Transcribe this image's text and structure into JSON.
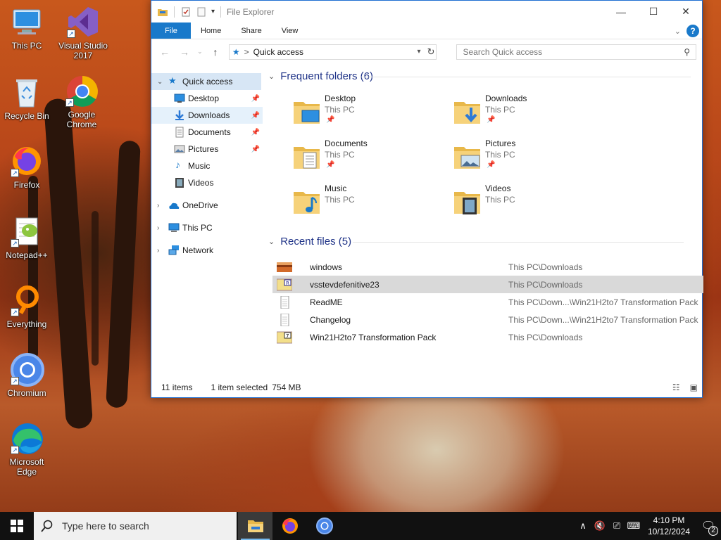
{
  "desktop": {
    "icons": [
      {
        "label": "This PC",
        "icon": "this-pc-icon"
      },
      {
        "label": "Visual Studio 2017",
        "icon": "visual-studio-icon"
      },
      {
        "label": "Recycle Bin",
        "icon": "recycle-bin-icon"
      },
      {
        "label": "Google Chrome",
        "icon": "chrome-icon"
      },
      {
        "label": "Firefox",
        "icon": "firefox-icon"
      },
      {
        "label": "Notepad++",
        "icon": "notepadpp-icon"
      },
      {
        "label": "Everything",
        "icon": "everything-icon"
      },
      {
        "label": "Chromium",
        "icon": "chromium-icon"
      },
      {
        "label": "Microsoft Edge",
        "icon": "edge-icon"
      }
    ]
  },
  "window": {
    "title": "File Explorer",
    "ribbon_tabs": [
      "File",
      "Home",
      "Share",
      "View"
    ],
    "address": {
      "location": "Quick access",
      "separator": ">"
    },
    "search_placeholder": "Search Quick access",
    "nav": {
      "quick_access": "Quick access",
      "pinned": [
        "Desktop",
        "Downloads",
        "Documents",
        "Pictures"
      ],
      "unpinned": [
        "Music",
        "Videos"
      ],
      "onedrive": "OneDrive",
      "this_pc": "This PC",
      "network": "Network"
    },
    "frequent": {
      "header": "Frequent folders (6)",
      "folders": [
        {
          "name": "Desktop",
          "location": "This PC",
          "pinned": true
        },
        {
          "name": "Downloads",
          "location": "This PC",
          "pinned": true
        },
        {
          "name": "Documents",
          "location": "This PC",
          "pinned": true
        },
        {
          "name": "Pictures",
          "location": "This PC",
          "pinned": true
        },
        {
          "name": "Music",
          "location": "This PC",
          "pinned": false
        },
        {
          "name": "Videos",
          "location": "This PC",
          "pinned": false
        }
      ]
    },
    "recent": {
      "header": "Recent files (5)",
      "files": [
        {
          "name": "windows",
          "path": "This PC\\Downloads"
        },
        {
          "name": "vsstevdefenitive23",
          "path": "This PC\\Downloads"
        },
        {
          "name": "ReadME",
          "path": "This PC\\Down...\\Win21H2to7 Transformation Pack"
        },
        {
          "name": "Changelog",
          "path": "This PC\\Down...\\Win21H2to7 Transformation Pack"
        },
        {
          "name": "Win21H2to7 Transformation Pack",
          "path": "This PC\\Downloads"
        }
      ]
    },
    "status": {
      "count": "11 items",
      "selection": "1 item selected",
      "size": "754 MB"
    }
  },
  "taskbar": {
    "search_placeholder": "Type here to search",
    "apps": [
      "file-explorer-icon",
      "firefox-icon",
      "chromium-icon"
    ],
    "time": "4:10 PM",
    "date": "10/12/2024",
    "notifications": "2"
  },
  "colors": {
    "accent": "#1979ca",
    "section_header": "#1e3287",
    "taskbar": "#111111"
  }
}
